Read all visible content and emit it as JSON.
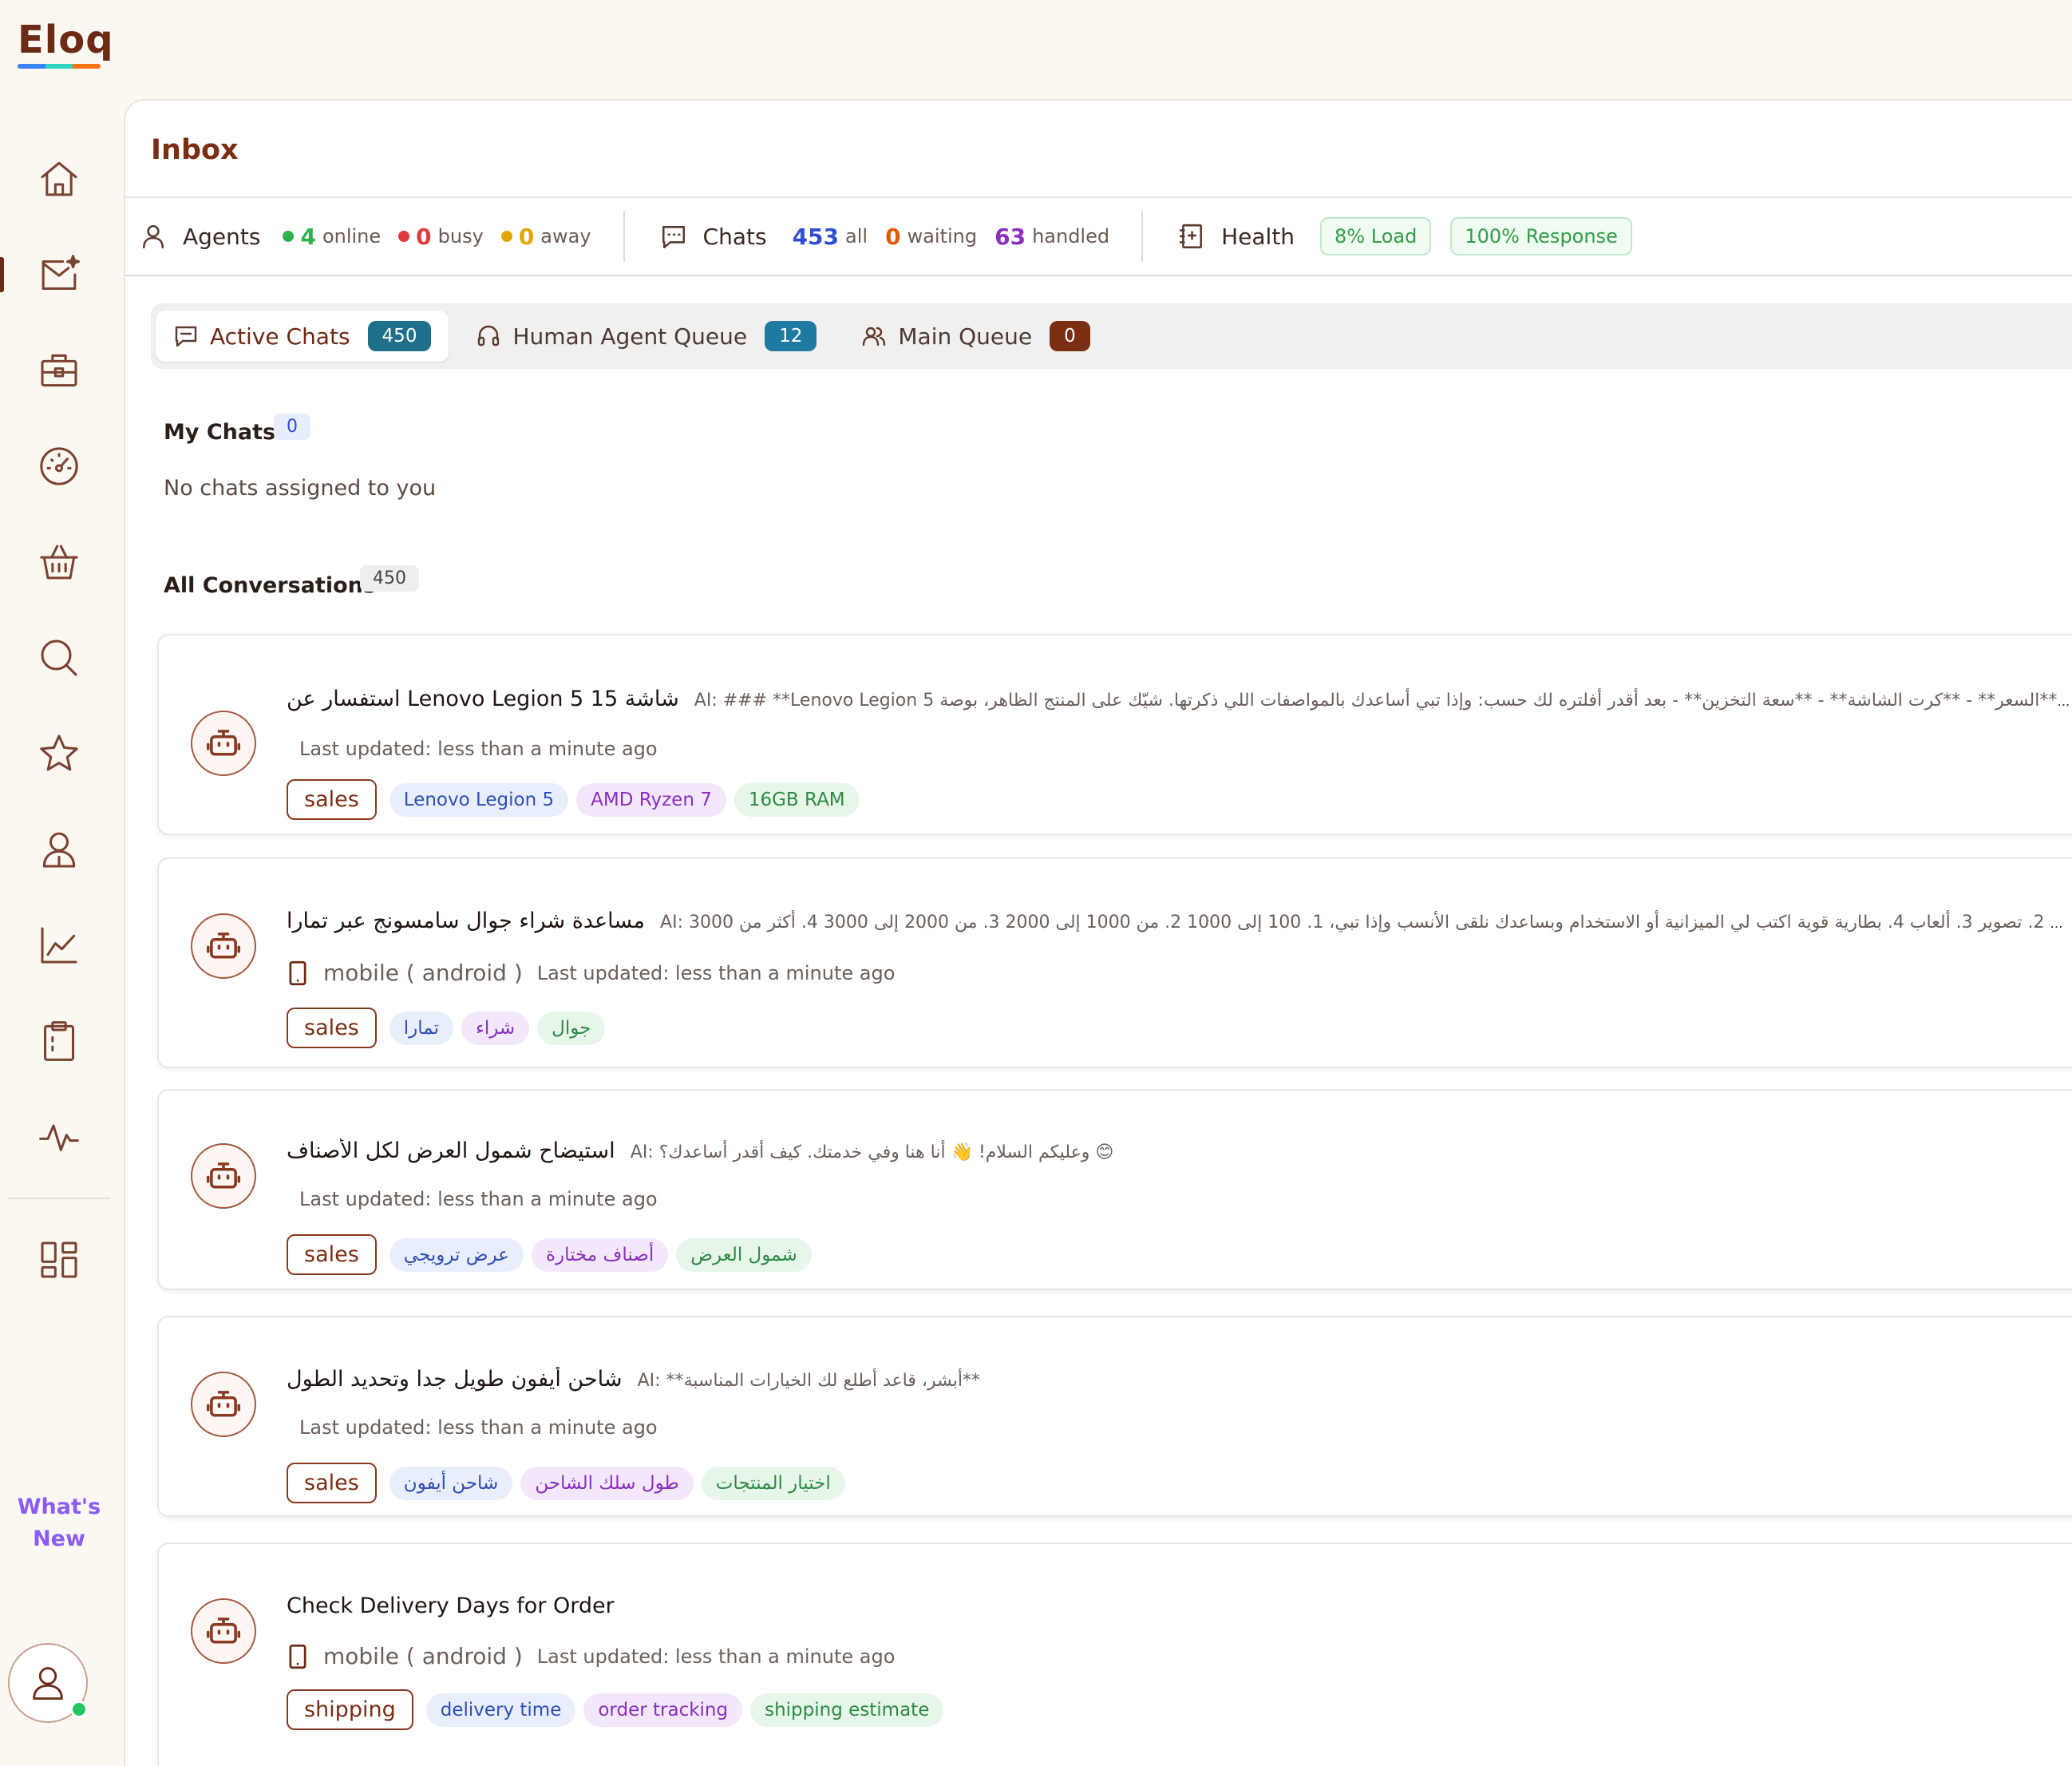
{
  "app": {
    "logo": "Eloq",
    "logo_colors": [
      "#3b82f6",
      "#2dd4bf",
      "#f97316"
    ],
    "whats_new": "What's New"
  },
  "sidebar": {
    "items": [
      {
        "name": "home-icon"
      },
      {
        "name": "inbox-icon",
        "active": true
      },
      {
        "name": "briefcase-icon"
      },
      {
        "name": "dashboard-gauge-icon"
      },
      {
        "name": "basket-icon"
      },
      {
        "name": "search-icon"
      },
      {
        "name": "star-icon"
      },
      {
        "name": "user-icon"
      },
      {
        "name": "chart-icon"
      },
      {
        "name": "clipboard-icon"
      },
      {
        "name": "activity-icon"
      },
      {
        "name": "apps-grid-icon"
      }
    ]
  },
  "header": {
    "title": "Inbox"
  },
  "stats": {
    "agents": {
      "label": "Agents",
      "online": {
        "value": "4",
        "label": "online",
        "color": "#2fb24c"
      },
      "busy": {
        "value": "0",
        "label": "busy",
        "color": "#e03a3a"
      },
      "away": {
        "value": "0",
        "label": "away",
        "color": "#e0a800"
      }
    },
    "chats": {
      "label": "Chats",
      "all": {
        "value": "453",
        "label": "all",
        "color": "#2f4fd0"
      },
      "waiting": {
        "value": "0",
        "label": "waiting",
        "color": "#e05a0a"
      },
      "handled": {
        "value": "63",
        "label": "handled",
        "color": "#8a2fc0"
      }
    },
    "health": {
      "label": "Health",
      "load": "8% Load",
      "response": "100% Response"
    }
  },
  "tabs": [
    {
      "label": "Active Chats",
      "count": "450",
      "color": "#1e6f8a"
    },
    {
      "label": "Human Agent Queue",
      "count": "12",
      "color": "#1e7aa0"
    },
    {
      "label": "Main Queue",
      "count": "0",
      "color": "#7a2e12"
    }
  ],
  "my_chats": {
    "title": "My Chats",
    "count": "0",
    "empty": "No chats assigned to you"
  },
  "all_conversations": {
    "title": "All Conversations",
    "count": "450"
  },
  "conversations": [
    {
      "title": "استفسار عن Lenovo Legion 5 15 شاشة",
      "preview": "AI: ### **Lenovo Legion 5 المعروض تحت فيه خيار 👍 مناسب** - **السعر** - **كرت الشاشة** - **سعة التخزين** - بعد أقدر أفلتره لك حسب: وإذا تبي أساعدك بالمواصفات اللي ذكرتها. شيّك على المنتج الظاهر، بوصة** ...",
      "device": "",
      "updated": "Last updated: less than a minute ago",
      "category": "sales",
      "tags": [
        "Lenovo Legion 5",
        "AMD Ryzen 7",
        "16GB RAM"
      ]
    },
    {
      "title": "مساعدة شراء جوال سامسونج عبر تمارا",
      "preview": "AI: أقدر أدور لك حسب استخدامك: 1. استخدام يومي 2. تصوير 3. ألعاب 4. بطارية قوية اكتب لي الميزانية أو الاستخدام وبساعدك نلقى الأنسب وإذا تبي، 1. 100 إلى 1000 2. من 1000 إلى 2000 3. من 2000 إلى 3000 4. أكثر من 3000 ...",
      "device": "mobile ( android )",
      "updated": "Last updated: less than a minute ago",
      "category": "sales",
      "tags": [
        "تمارا",
        "شراء",
        "جوال"
      ]
    },
    {
      "title": "استيضاح شمول العرض لكل الأصناف",
      "preview": "AI: وعليكم السلام! 👋 أنا هنا وفي خدمتك. كيف أقدر أساعدك؟ 😊",
      "device": "",
      "updated": "Last updated: less than a minute ago",
      "category": "sales",
      "tags": [
        "عرض ترويجي",
        "أصناف مختارة",
        "شمول العرض"
      ]
    },
    {
      "title": "شاحن أيفون طويل جدا وتحديد الطول",
      "preview": "AI: **أبشر، قاعد أطلع لك الخيارات المناسبة**",
      "device": "",
      "updated": "Last updated: less than a minute ago",
      "category": "sales",
      "tags": [
        "شاحن أيفون",
        "طول سلك الشاحن",
        "اختيار المنتجات"
      ]
    },
    {
      "title": "Check Delivery Days for Order",
      "preview": "",
      "device": "mobile ( android )",
      "updated": "Last updated: less than a minute ago",
      "category": "shipping",
      "tags": [
        "delivery time",
        "order tracking",
        "shipping estimate"
      ]
    }
  ]
}
